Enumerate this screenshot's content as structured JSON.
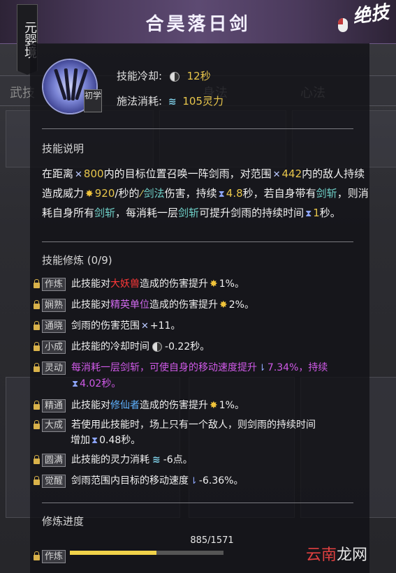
{
  "header": {
    "title": "合昊落日剑",
    "realm": "元婴境",
    "ultimate_label": "绝技"
  },
  "background_tabs": [
    "武技",
    "身法",
    "心法"
  ],
  "skill": {
    "level_label": "初学",
    "cooldown_label": "技能冷却:",
    "cooldown_value": "12秒",
    "cost_label": "施法消耗:",
    "cost_value": "105灵力"
  },
  "description": {
    "title": "技能说明",
    "p1": "在距离",
    "range1": "800",
    "p2": "内的目标位置召唤一阵剑雨，对范围",
    "range2": "442",
    "p3": "内的敌人持续造成威力",
    "power": "920",
    "p4": "/秒的",
    "element": "剑法",
    "p5": "伤害，持续",
    "duration": "4.8",
    "p6": "秒，若自身带有",
    "term1": "剑斩",
    "p7": "，则消耗自身所有",
    "term2": "剑斩",
    "p8": "，每消耗一层",
    "term3": "剑斩",
    "p9": "可提升剑雨的持续时间",
    "extra": "1",
    "p10": "秒。"
  },
  "training": {
    "title": "技能修炼 (0/9)",
    "rows": [
      {
        "tier": "作炼",
        "a": "此技能对",
        "hl": "大妖兽",
        "b": "造成的伤害提升",
        "val": "1%。"
      },
      {
        "tier": "娴熟",
        "a": "此技能对",
        "hl": "精英单位",
        "b": "造成的伤害提升",
        "val": "2%。"
      },
      {
        "tier": "通晓",
        "a": "剑雨的伤害范围",
        "hl": "",
        "b": "",
        "val": "+11。"
      },
      {
        "tier": "小成",
        "a": "此技能的冷却时间",
        "hl": "",
        "b": "",
        "val": "-0.22秒。"
      },
      {
        "tier": "灵动",
        "line1": "每消耗一层剑斩，可使自身的移动速度提升",
        "val1": "7.34%，持续",
        "val2": "4.02秒。"
      },
      {
        "tier": "精通",
        "a": "此技能对",
        "hl": "修仙者",
        "b": "造成的伤害提升",
        "val": "1%。"
      },
      {
        "tier": "大成",
        "line1": "若使用此技能时，场上只有一个敌人，则剑雨的持续时间",
        "line2": "增加",
        "val": "0.48秒。"
      },
      {
        "tier": "圆满",
        "a": "此技能的灵力消耗",
        "hl": "",
        "b": "",
        "val": "-6点。"
      },
      {
        "tier": "觉醒",
        "a": "剑雨范围内目标的移动速度",
        "hl": "",
        "b": "",
        "val": "-6.36%。"
      }
    ]
  },
  "progress": {
    "title": "修炼进度",
    "text": "885/1571",
    "tier": "作炼",
    "fraction": 0.5633
  },
  "watermark": {
    "a": "云南",
    "b": "龙网"
  }
}
